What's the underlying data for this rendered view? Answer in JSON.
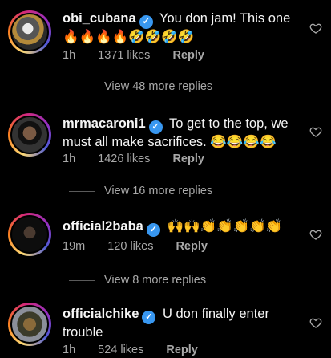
{
  "comments": [
    {
      "username": "obi_cubana",
      "text": "You don jam! This one",
      "emoji": "🔥🔥🔥🔥🤣🤣🤣🤣",
      "time": "1h",
      "likes": "1371 likes",
      "reply": "Reply"
    },
    {
      "username": "mrmacaroni1",
      "text": "To get to the top, we must all make sacrifices.",
      "emoji": "😂😂😂😂",
      "time": "1h",
      "likes": "1426 likes",
      "reply": "Reply"
    },
    {
      "username": "official2baba",
      "text": "",
      "emoji": "🙌🙌👏👏👏👏👏",
      "time": "19m",
      "likes": "120 likes",
      "reply": "Reply"
    },
    {
      "username": "officialchike",
      "text": "U don finally enter trouble",
      "emoji": "",
      "time": "1h",
      "likes": "524 likes",
      "reply": "Reply"
    }
  ],
  "view_more": [
    "View 48 more replies",
    "View 16 more replies",
    "View 8 more replies"
  ],
  "verified_badge": "✓",
  "colors": {
    "background": "#000000",
    "verified": "#3897f0",
    "muted": "#a8a8a8"
  }
}
